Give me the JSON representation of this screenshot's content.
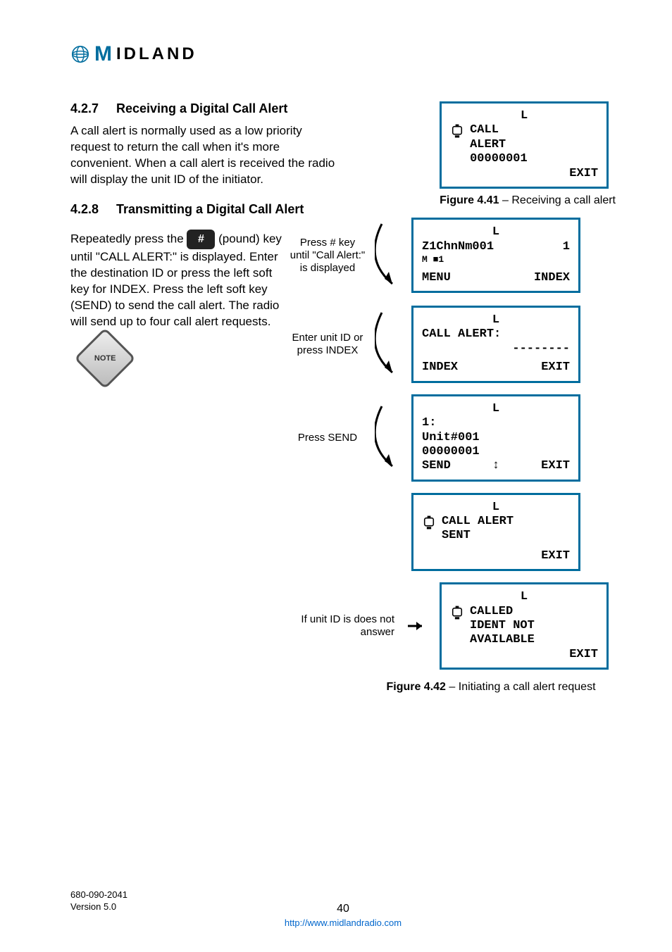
{
  "logo_text": "IDLAND",
  "sections": {
    "s427": {
      "num": "4.2.7",
      "title": "Receiving a Digital Call Alert"
    },
    "s428": {
      "num": "4.2.8",
      "title": "Transmitting a Digital Call Alert"
    }
  },
  "paragraphs": {
    "p1": "A call alert is normally used as a low priority request to return the call when it's more convenient. When a call alert is received the radio will display the unit ID of the initiator.",
    "p2a": "Repeatedly press the ",
    "p2b": " (pound) key until \"CALL ALERT:\" is displayed. Enter the destination ID or press the left soft key for INDEX. Press the left soft key (SEND) to send the call alert. The radio will send up to four call alert requests."
  },
  "pound_symbol": "#",
  "note_label": "NOTE",
  "lcds": {
    "rx": {
      "top": "L",
      "l1": "CALL",
      "l2": "ALERT",
      "l3": "00000001",
      "right": "EXIT"
    },
    "home": {
      "top": "L",
      "l1": "Z1ChnNm001",
      "num": "1",
      "icons": "M  ■1",
      "left": "MENU",
      "right": "INDEX"
    },
    "enter": {
      "top": "L",
      "l1": "CALL ALERT:",
      "l2": "--------",
      "left": "INDEX",
      "right": "EXIT"
    },
    "index": {
      "top": "L",
      "l1": "1:",
      "l2": "Unit#001",
      "l3": "00000001",
      "left": "SEND",
      "mid": "↕",
      "right": "EXIT"
    },
    "sent": {
      "top": "L",
      "l1": "CALL ALERT",
      "l2": "SENT",
      "right": "EXIT"
    },
    "fail": {
      "top": "L",
      "l1": "CALLED",
      "l2": "IDENT NOT",
      "l3": "AVAILABLE",
      "right": "EXIT"
    }
  },
  "flow_labels": {
    "a": "Press # key until \"Call Alert:\" is displayed",
    "b": "Enter unit ID or press INDEX",
    "c": "Press SEND",
    "d": "If unit ID is does not answer"
  },
  "figures": {
    "f41": {
      "bold": "Figure 4.41",
      "rest": " – Receiving a call alert"
    },
    "f42": {
      "bold": "Figure 4.42",
      "rest": " – Initiating a call alert request"
    }
  },
  "footer": {
    "docnum": "680-090-2041",
    "version": "Version 5.0",
    "page": "40",
    "url": "http://www.midlandradio.com"
  }
}
